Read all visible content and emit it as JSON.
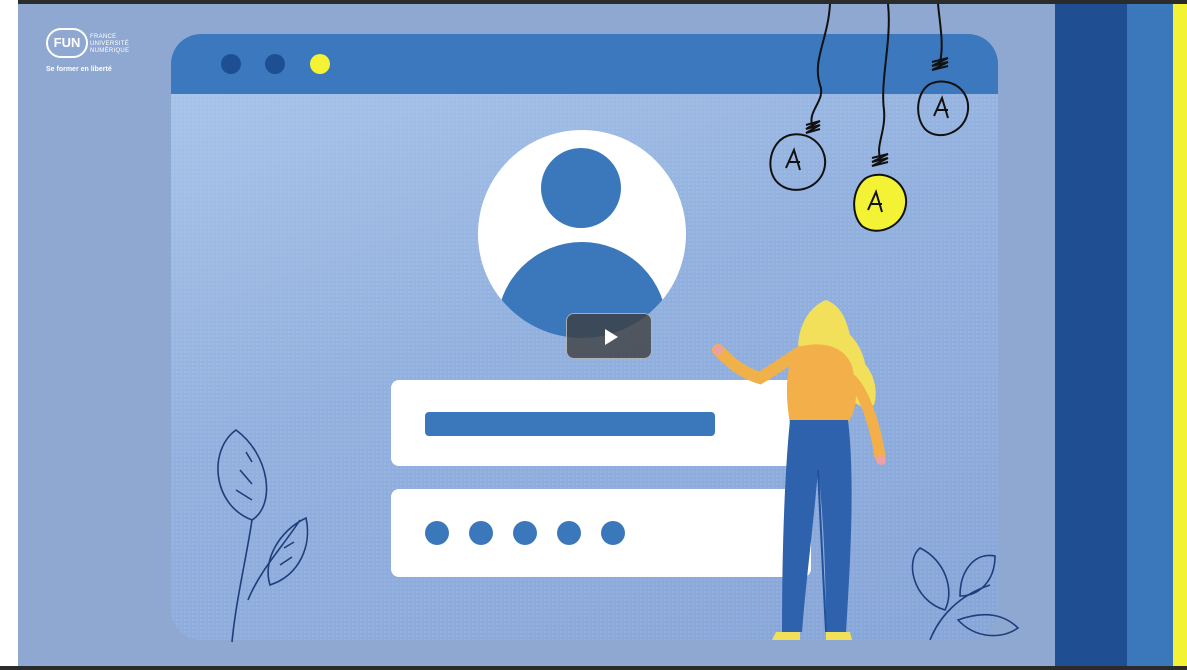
{
  "logo": {
    "badge": "FUN",
    "lines": [
      "FRANCE",
      "UNIVERSITÉ",
      "NUMÉRIQUE"
    ],
    "tagline": "Se former en liberté"
  },
  "player": {
    "play_icon": "play-icon"
  },
  "window": {
    "dot_colors": [
      "#1f4f93",
      "#1f4f93",
      "#f3f235"
    ],
    "password_dot_count": 5
  },
  "colors": {
    "background": "#8fa8d2",
    "accent_blue": "#3a78bb",
    "dark_blue": "#1f4e92",
    "yellow": "#f3f235"
  }
}
